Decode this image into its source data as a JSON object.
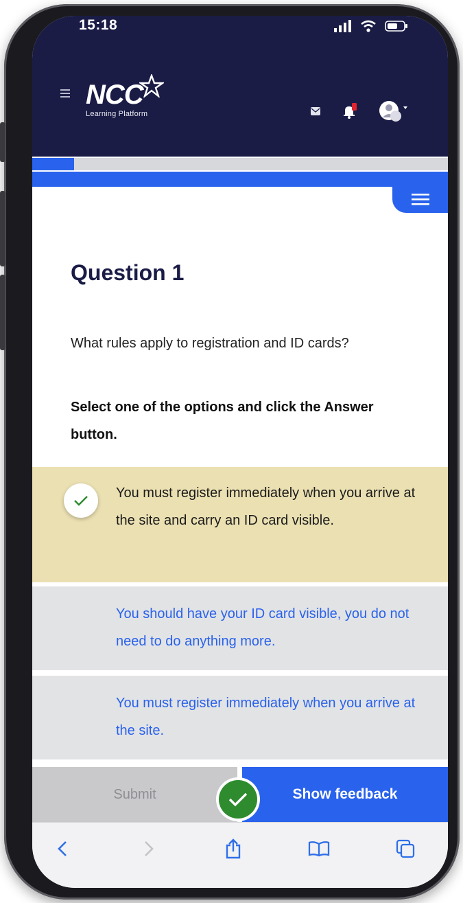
{
  "status_bar": {
    "time": "15:18"
  },
  "header": {
    "logo_text": "NCC",
    "logo_subtitle": "Learning Platform"
  },
  "progress": {
    "fraction": 0.1
  },
  "question": {
    "title": "Question 1",
    "text": "What rules apply to registration and ID cards?",
    "instruction": "Select one of the options and click the Answer button."
  },
  "options": [
    {
      "label": "You must register immediately when you arrive at the site and carry an ID card visible.",
      "selected": true
    },
    {
      "label": "You should have your ID card visible, you do not need to do anything more.",
      "selected": false
    },
    {
      "label": "You must register immediately when you arrive at the site.",
      "selected": false
    }
  ],
  "buttons": {
    "submit_label": "Submit",
    "feedback_label": "Show feedback"
  },
  "colors": {
    "header_bg": "#1a1c46",
    "accent": "#2962ec",
    "selected_option_bg": "#ebe0b2",
    "option_bg": "#e2e3e5",
    "correct_green": "#2e8b2e"
  },
  "icons": {
    "menu": "hamburger-icon",
    "message": "message-icon",
    "notification": "bell-icon",
    "avatar": "avatar-icon",
    "check": "checkmark-icon",
    "back": "chevron-left-icon",
    "forward": "chevron-right-icon",
    "share": "share-icon",
    "bookmarks": "book-icon",
    "tabs": "tabs-icon"
  }
}
